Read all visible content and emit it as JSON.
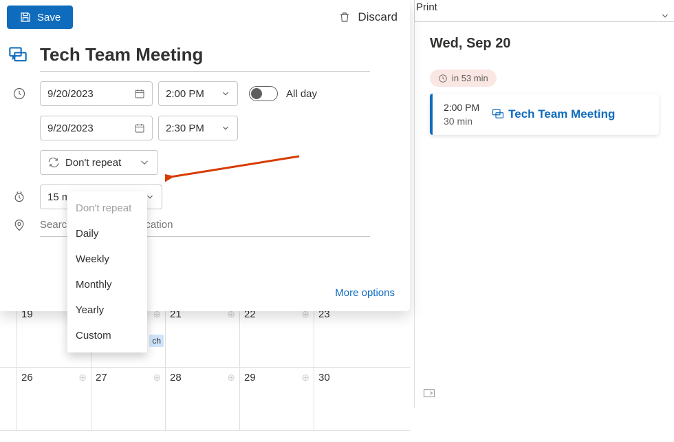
{
  "toolbar": {
    "save": "Save",
    "discard": "Discard",
    "print": "Print"
  },
  "event": {
    "title": "Tech Team Meeting",
    "start_date": "9/20/2023",
    "start_time": "2:00 PM",
    "end_date": "9/20/2023",
    "end_time": "2:30 PM",
    "all_day_label": "All day",
    "all_day": false,
    "repeat_selected": "Don't repeat",
    "reminder": "15 m",
    "location_placeholder": "Search for a room or location"
  },
  "repeat_options": [
    "Don't repeat",
    "Daily",
    "Weekly",
    "Monthly",
    "Yearly",
    "Custom"
  ],
  "more_options": "More options",
  "preview": {
    "date_heading": "Wed, Sep 20",
    "countdown": "in 53 min",
    "event_time": "2:00 PM",
    "event_duration": "30 min",
    "event_title": "Tech Team Meeting"
  },
  "calendar": {
    "row1": [
      "19",
      "",
      "21",
      "22",
      "23"
    ],
    "row2": [
      "26",
      "27",
      "28",
      "29",
      "30"
    ],
    "chip": "ch"
  }
}
